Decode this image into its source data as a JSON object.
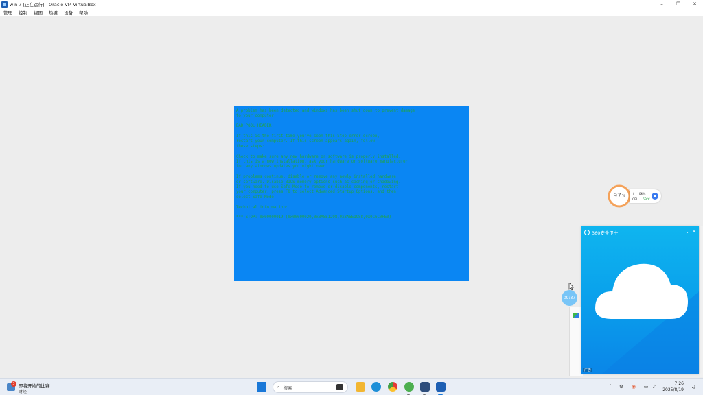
{
  "window": {
    "title": "win 7 [正在运行] - Oracle VM VirtualBox",
    "minimize": "–",
    "restore": "❐",
    "close": "✕"
  },
  "menu": [
    "管理",
    "控制",
    "视图",
    "热键",
    "设备",
    "帮助"
  ],
  "bsod": {
    "lines": [
      "A problem has been detected and windows has been shut down to prevent damage\nto your computer.",
      "BAD_POOL_HEADER",
      "If this is the first time you've seen this Stop error screen,\nrestart your computer. If this screen appears again, follow\nthese steps:",
      "Check to make sure any new hardware or software is properly installed.\nIf this is a new installation, ask your hardware or software manufacturer\nfor any windows updates you might need.",
      "If problems continue, disable or remove any newly installed hardware\nor software. Disable BIOS memory options such as caching or shadowing.\nIf you need to use Safe Mode to remove or disable components, restart\nyour computer, press F8 to select Advanced Startup Options, and then\nselect Safe Mode.",
      "Technical information:",
      "*** STOP: 0x00000019 (0x00000020,0x8A5E1298,0x8A5E1988,0x0C6C0FE0)"
    ],
    "background": "#0a86f3",
    "text_color": "#1fa34a"
  },
  "widget": {
    "percent": "97",
    "percent_unit": "%",
    "net_speed": "0K/s",
    "cpu_label": "CPU",
    "cpu_temp": "59℃"
  },
  "popup": {
    "title": "360安全卫士",
    "ad_label": "广告",
    "collapse_icon": "chevron-down-icon",
    "close_icon": "close-icon"
  },
  "timer": "09:37",
  "taskbar": {
    "weather_badge": "3",
    "weather_title": "即将开始的比赛",
    "weather_sub": "财经",
    "search_placeholder": "搜索",
    "time": "7:26",
    "date": "2025/8/19"
  }
}
